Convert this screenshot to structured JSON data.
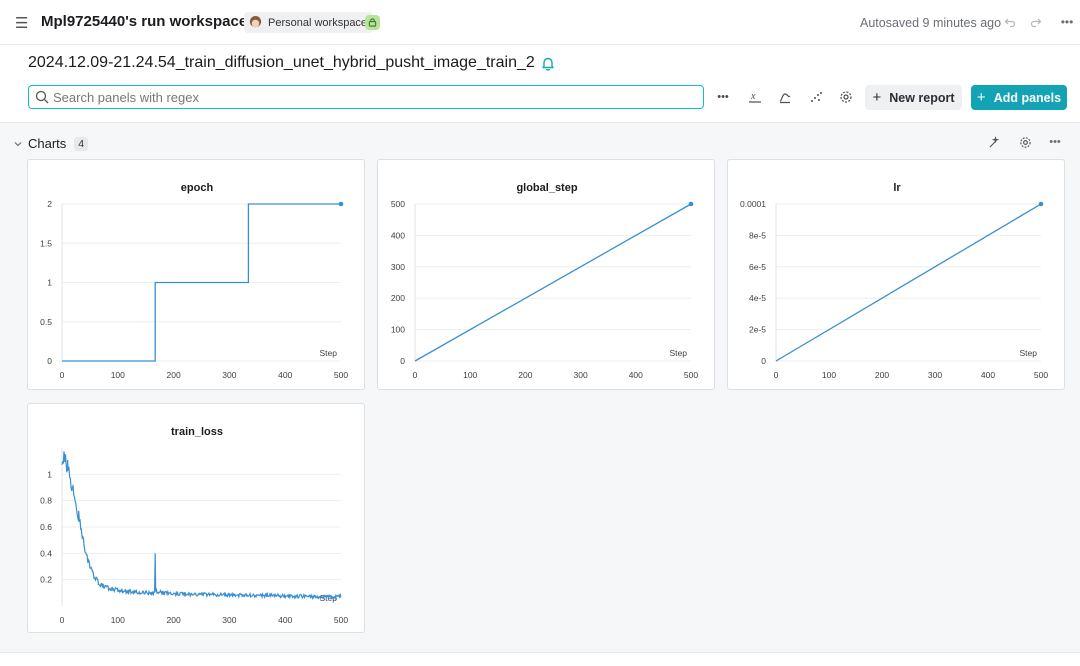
{
  "header": {
    "workspace_title": "Mpl9725440's run workspace",
    "workspace_badge": "Personal workspace",
    "autosave": "Autosaved 9 minutes ago"
  },
  "run": {
    "name": "2024.12.09-21.24.54_train_diffusion_unet_hybrid_pusht_image_train_2"
  },
  "search": {
    "placeholder": "Search panels with regex"
  },
  "toolbar": {
    "new_report_label": "New report",
    "add_panels_label": "Add panels"
  },
  "section": {
    "title": "Charts",
    "count": "4"
  },
  "colors": {
    "accent": "#12a4b4",
    "series": "#3a8fd1",
    "search_border": "#10bfcc"
  },
  "chart_data": [
    {
      "type": "line",
      "title": "epoch",
      "xlabel": "Step",
      "xlim": [
        0,
        500
      ],
      "ylim": [
        0,
        2
      ],
      "xticks": [
        "0",
        "100",
        "200",
        "300",
        "400",
        "500"
      ],
      "yticks": [
        "0",
        "0.5",
        "1",
        "1.5",
        "2"
      ],
      "series": [
        {
          "x": [
            0,
            167,
            167,
            334,
            334,
            500
          ],
          "y": [
            0,
            0,
            1,
            1,
            2,
            2
          ]
        }
      ]
    },
    {
      "type": "line",
      "title": "global_step",
      "xlabel": "Step",
      "xlim": [
        0,
        500
      ],
      "ylim": [
        0,
        500
      ],
      "xticks": [
        "0",
        "100",
        "200",
        "300",
        "400",
        "500"
      ],
      "yticks": [
        "0",
        "100",
        "200",
        "300",
        "400",
        "500"
      ],
      "series": [
        {
          "x": [
            0,
            500
          ],
          "y": [
            0,
            500
          ]
        }
      ]
    },
    {
      "type": "line",
      "title": "lr",
      "xlabel": "Step",
      "xlim": [
        0,
        500
      ],
      "ylim": [
        0,
        0.0001
      ],
      "xticks": [
        "0",
        "100",
        "200",
        "300",
        "400",
        "500"
      ],
      "yticks": [
        "0",
        "2e-5",
        "4e-5",
        "6e-5",
        "8e-5",
        "0.0001"
      ],
      "series": [
        {
          "x": [
            0,
            500
          ],
          "y": [
            0,
            0.0001
          ]
        }
      ]
    },
    {
      "type": "line",
      "title": "train_loss",
      "xlabel": "Step",
      "xlim": [
        0,
        500
      ],
      "ylim": [
        0,
        1.2
      ],
      "xticks": [
        "0",
        "100",
        "200",
        "300",
        "400",
        "500"
      ],
      "yticks": [
        "0.2",
        "0.4",
        "0.6",
        "0.8",
        "1"
      ],
      "series": [
        {
          "x": [
            0,
            5,
            10,
            15,
            20,
            25,
            30,
            35,
            40,
            45,
            50,
            55,
            60,
            65,
            70,
            80,
            90,
            100,
            110,
            120,
            130,
            140,
            150,
            160,
            166,
            167,
            168,
            180,
            200,
            225,
            250,
            275,
            300,
            325,
            350,
            375,
            400,
            425,
            450,
            475,
            500
          ],
          "y": [
            1.14,
            1.1,
            1.05,
            0.97,
            0.87,
            0.78,
            0.68,
            0.56,
            0.45,
            0.37,
            0.3,
            0.25,
            0.21,
            0.18,
            0.16,
            0.14,
            0.13,
            0.12,
            0.115,
            0.11,
            0.105,
            0.1,
            0.1,
            0.095,
            0.1,
            0.4,
            0.11,
            0.1,
            0.095,
            0.09,
            0.09,
            0.085,
            0.085,
            0.08,
            0.08,
            0.08,
            0.075,
            0.075,
            0.07,
            0.07,
            0.07
          ]
        }
      ]
    }
  ]
}
